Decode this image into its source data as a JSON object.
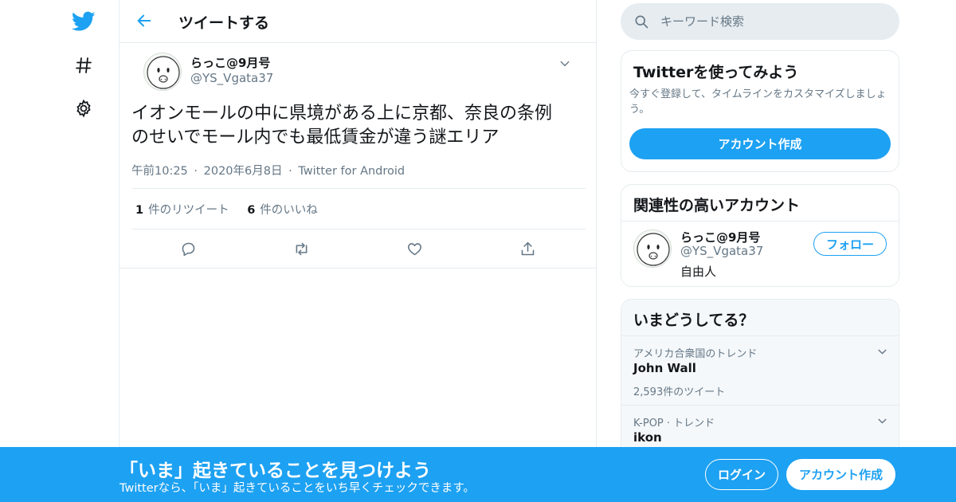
{
  "colors": {
    "accent": "#1da1f2",
    "text": "#14171a",
    "muted": "#657786",
    "border": "#e6ecf0"
  },
  "nav": {
    "icons": [
      "twitter-bird-icon",
      "hashtag-icon",
      "gear-icon"
    ]
  },
  "header": {
    "title": "ツイートする",
    "back_icon": "back-arrow-icon"
  },
  "tweet": {
    "author_name": "らっこ@9月号",
    "author_handle": "@YS_Vgata37",
    "text_line1": "イオンモールの中に県境がある上に京都、奈良の条例",
    "text_line2": "のせいでモール内でも最低賃金が違う謎エリア",
    "time": "午前10:25",
    "date": "2020年6月8日",
    "source": "Twitter for Android",
    "dot": "·",
    "retweet_count": "1",
    "retweet_label": "件のリツイート",
    "like_count": "6",
    "like_label": "件のいいね"
  },
  "search": {
    "placeholder": "キーワード検索"
  },
  "signup_card": {
    "title": "Twitterを使ってみよう",
    "description": "今すぐ登録して、タイムラインをカスタマイズしましょう。",
    "button": "アカウント作成"
  },
  "related": {
    "title": "関連性の高いアカウント",
    "name": "らっこ@9月号",
    "handle": "@YS_Vgata37",
    "bio": "自由人",
    "follow": "フォロー"
  },
  "trends": {
    "title": "いまどうしてる？",
    "items": [
      {
        "context": "アメリカ合衆国のトレンド",
        "name": "John Wall",
        "count": "2,593件のツイート"
      },
      {
        "context": "K-POP · トレンド",
        "name": "ikon",
        "count": ""
      }
    ]
  },
  "banner": {
    "title": "「いま」起きていることを見つけよう",
    "subtitle": "Twitterなら、「いま」起きていることをいち早くチェックできます。",
    "login": "ログイン",
    "signup": "アカウント作成"
  }
}
